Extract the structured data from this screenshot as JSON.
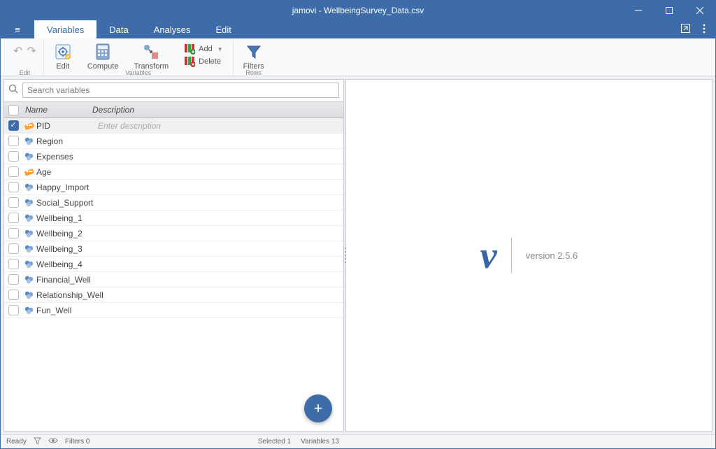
{
  "window": {
    "title": "jamovi - WellbeingSurvey_Data.csv"
  },
  "tabs": {
    "hamburger": "≡",
    "items": [
      "Variables",
      "Data",
      "Analyses",
      "Edit"
    ],
    "active_index": 0
  },
  "ribbon": {
    "edit_group_label": "Edit",
    "undo": "↶",
    "redo": "↷",
    "edit_label": "Edit",
    "compute_label": "Compute",
    "transform_label": "Transform",
    "vars_group_label": "Variables",
    "add_label": "Add",
    "delete_label": "Delete",
    "filters_label": "Filters",
    "rows_group_label": "Rows"
  },
  "search": {
    "placeholder": "Search variables"
  },
  "var_table": {
    "hdr_name": "Name",
    "hdr_desc": "Description",
    "desc_placeholder": "Enter description",
    "rows": [
      {
        "name": "PID",
        "type": "id",
        "checked": true,
        "selected": true
      },
      {
        "name": "Region",
        "type": "nom",
        "checked": false,
        "selected": false
      },
      {
        "name": "Expenses",
        "type": "nom",
        "checked": false,
        "selected": false
      },
      {
        "name": "Age",
        "type": "id",
        "checked": false,
        "selected": false
      },
      {
        "name": "Happy_Import",
        "type": "nom",
        "checked": false,
        "selected": false
      },
      {
        "name": "Social_Support",
        "type": "nom",
        "checked": false,
        "selected": false
      },
      {
        "name": "Wellbeing_1",
        "type": "nom",
        "checked": false,
        "selected": false
      },
      {
        "name": "Wellbeing_2",
        "type": "nom",
        "checked": false,
        "selected": false
      },
      {
        "name": "Wellbeing_3",
        "type": "nom",
        "checked": false,
        "selected": false
      },
      {
        "name": "Wellbeing_4",
        "type": "nom",
        "checked": false,
        "selected": false
      },
      {
        "name": "Financial_Well",
        "type": "nom",
        "checked": false,
        "selected": false
      },
      {
        "name": "Relationship_Well",
        "type": "nom",
        "checked": false,
        "selected": false
      },
      {
        "name": "Fun_Well",
        "type": "nom",
        "checked": false,
        "selected": false
      }
    ]
  },
  "splash": {
    "version": "version 2.5.6"
  },
  "status": {
    "ready": "Ready",
    "filters": "Filters 0",
    "selected": "Selected 1",
    "variables": "Variables 13"
  },
  "fab": {
    "plus": "+"
  }
}
